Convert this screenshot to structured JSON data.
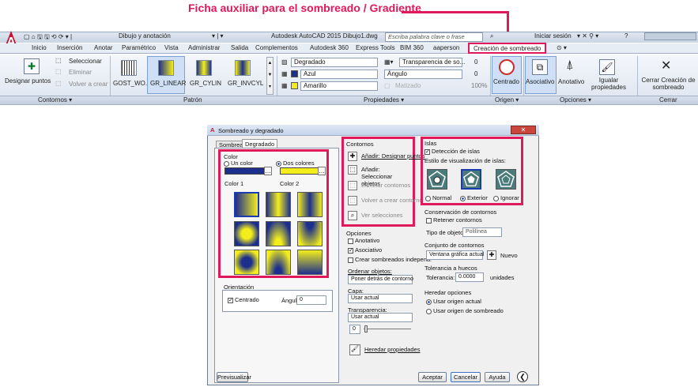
{
  "caption": "Ficha auxiliar para el sombreado / Gradiente",
  "titlebar": {
    "title": "Autodesk AutoCAD 2015   Dibujo1.dwg",
    "workspace": "Dibujo y anotación",
    "search_placeholder": "Escriba palabra clave o frase",
    "signin": "Iniciar sesión",
    "help": "?"
  },
  "tabs": [
    "Inicio",
    "Inserción",
    "Anotar",
    "Paramétrico",
    "Vista",
    "Administrar",
    "Salida",
    "Complementos",
    "Autodesk 360",
    "Express Tools",
    "BIM 360",
    "aaperson"
  ],
  "active_tab": "Creación de sombreado",
  "ribbon": {
    "pick_points": "Designar puntos",
    "select": "Seleccionar",
    "remove": "Eliminar",
    "recreate": "Volver a crear",
    "patterns": [
      "GOST_WO...",
      "GR_LINEAR",
      "GR_CYLIN",
      "GR_INVCYL"
    ],
    "type": "Degradado",
    "color1": "Azul",
    "color2": "Amarillo",
    "transparency_label": "Transparencia de so...",
    "transparency_value": "0",
    "angle_label": "Ángulo",
    "angle_value": "0",
    "shade_label": "Matizado",
    "shade_value": "100%",
    "center": "Centrado",
    "associative": "Asociativo",
    "annotative": "Anotativo",
    "match": "Igualar propiedades",
    "close": "Cerrar Creación de sombreado",
    "panels": {
      "boundaries": "Contornos ▾",
      "pattern": "Patrón",
      "properties": "Propiedades ▾",
      "origin": "Origen ▾",
      "options": "Opciones ▾",
      "close": "Cerrar"
    }
  },
  "dialog": {
    "title": "Sombreado y degradado",
    "tab_hatch": "Sombreado",
    "tab_gradient": "Degradado",
    "color_label": "Color",
    "one_color": "Un color",
    "two_colors": "Dos colores",
    "color1": "Color 1",
    "color2": "Color 2",
    "orientation": "Orientación",
    "centered": "Centrado",
    "angle_label": "Ángulo:",
    "angle_value": "0",
    "boundaries": "Contornos",
    "add_pick": "Añadir: Designar puntos",
    "add_select": "Añadir: Seleccionar objetos",
    "remove_bounds": "Eliminar contornos",
    "recreate_bounds": "Volver a crear contorno",
    "view_sel": "Ver selecciones",
    "options": "Opciones",
    "annotative": "Anotativo",
    "associative": "Asociativo",
    "independent": "Crear sombreados independ.",
    "draw_order": "Ordenar objetos:",
    "draw_order_value": "Poner detrás de contorno",
    "layer": "Capa:",
    "layer_value": "Usar actual",
    "transparency": "Transparencia:",
    "transparency_value": "Usar actual",
    "transp_num": "0",
    "inherit": "Heredar propiedades",
    "islands": "Islas",
    "island_detect": "Detección de islas",
    "island_style": "Estilo de visualización de islas:",
    "normal": "Normal",
    "outer": "Exterior",
    "ignore": "Ignorar",
    "retain": "Conservación de contornos",
    "retain_chk": "Retener contornos",
    "obj_type": "Tipo de objeto:",
    "obj_type_value": "Polilínea",
    "boundary_set": "Conjunto de contornos",
    "boundary_set_value": "Ventana gráfica actual",
    "new": "Nuevo",
    "gap_tol": "Tolerancia a huecos",
    "tolerance": "Tolerancia:",
    "tolerance_value": "0.0000",
    "units": "unidades",
    "inherit_opts": "Heredar opciones",
    "use_current": "Usar origen actual",
    "use_source": "Usar origen de sombreado",
    "preview": "Previsualizar",
    "ok": "Aceptar",
    "cancel": "Cancelar",
    "help": "Ayuda"
  },
  "colors": {
    "accent": "#e0195a",
    "blue": "#1d2f8c",
    "yellow": "#f3ee1b"
  }
}
